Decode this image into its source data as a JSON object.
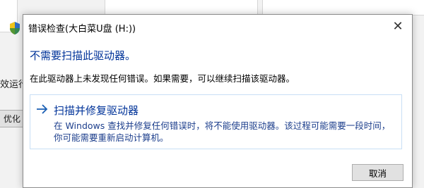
{
  "background": {
    "left_text": "效运行",
    "optimize_button": "优化"
  },
  "dialog": {
    "title": "错误检查(大白菜U盘 (H:))",
    "heading": "不需要扫描此驱动器。",
    "message": "在此驱动器上未发现任何错误。如果需要，可以继续扫描该驱动器。",
    "action": {
      "title": "扫描并修复驱动器",
      "description": "在 Windows 查找并修复任何错误时，将不能使用驱动器。该过程可能需要一段时间，你可能需要重新启动计算机。"
    },
    "cancel_label": "取消"
  },
  "icons": {
    "title_icon": "shield-icon",
    "close": "close-icon",
    "action_arrow": "arrow-right-icon"
  },
  "colors": {
    "link_blue": "#003399",
    "action_border": "#c8dff5"
  }
}
